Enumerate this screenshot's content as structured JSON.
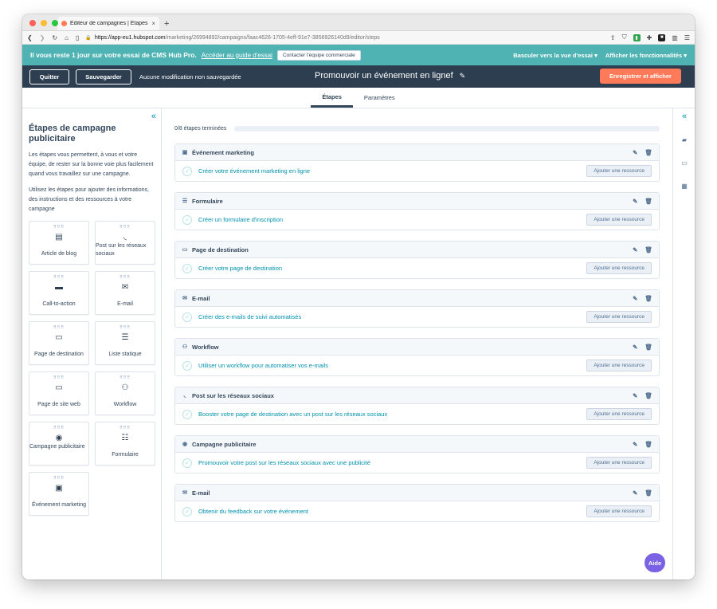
{
  "browser": {
    "tab_title": "Éditeur de campagnes | Étapes",
    "new_tab": "+",
    "url_host": "https://app-eu1.hubspot.com",
    "url_path": "/marketing/26994892/campaigns/faac4626-1705-4eff-91e7-3856926140d9/editor/steps"
  },
  "trial": {
    "message": "Il vous reste 1 jour sur votre essai de CMS Hub Pro.",
    "guide_link": "Accéder au guide d'essai",
    "contact_button": "Contacter l'équipe commerciale",
    "switch_view": "Basculer vers la vue d'essai ▾",
    "show_features": "Afficher les fonctionnalités ▾"
  },
  "editor": {
    "quit_label": "Quitter",
    "save_label": "Sauvegarder",
    "unsaved_status": "Aucune modification non sauvegardée",
    "campaign_title": "Promouvoir un événement en lignef",
    "publish_label": "Enregistrer et afficher"
  },
  "tabs": {
    "steps": "Étapes",
    "settings": "Paramètres"
  },
  "sidebar": {
    "title": "Étapes de campagne publicitaire",
    "para1": "Les étapes vous permettent, à vous et votre équipe, de rester sur la bonne voie plus facilement quand vous travaillez sur une campagne.",
    "para2": "Utilisez les étapes pour ajouter des informations, des instructions et des ressources à votre campagne",
    "tiles": [
      {
        "label": "Article de blog",
        "icon": "document-icon"
      },
      {
        "label": "Post sur les réseaux sociaux",
        "icon": "rss-icon"
      },
      {
        "label": "Call-to-action",
        "icon": "cta-icon"
      },
      {
        "label": "E-mail",
        "icon": "email-icon"
      },
      {
        "label": "Page de destination",
        "icon": "browser-icon"
      },
      {
        "label": "Liste statique",
        "icon": "list-icon"
      },
      {
        "label": "Page de site web",
        "icon": "browser-icon"
      },
      {
        "label": "Workflow",
        "icon": "workflow-icon"
      },
      {
        "label": "Campagne publicitaire",
        "icon": "ad-icon"
      },
      {
        "label": "Formulaire",
        "icon": "form-icon"
      },
      {
        "label": "Événement marketing",
        "icon": "event-icon"
      }
    ]
  },
  "progress": {
    "label": "0/8 étapes terminées",
    "fraction": 0
  },
  "steps": [
    {
      "type": "Événement marketing",
      "action": "Créer votre événement marketing en ligne",
      "button": "Ajouter une ressource"
    },
    {
      "type": "Formulaire",
      "action": "Créer un formulaire d'inscription",
      "button": "Ajouter une ressource"
    },
    {
      "type": "Page de destination",
      "action": "Créer votre page de destination",
      "button": "Ajouter une ressource"
    },
    {
      "type": "E-mail",
      "action": "Créer des e-mails de suivi automatisés",
      "button": "Ajouter une ressource"
    },
    {
      "type": "Workflow",
      "action": "Utiliser un workflow pour automatiser vos e-mails",
      "button": "Ajouter une ressource"
    },
    {
      "type": "Post sur les réseaux sociaux",
      "action": "Booster votre page de destination avec un post sur les réseaux sociaux",
      "button": "Ajouter une ressource"
    },
    {
      "type": "Campagne publicitaire",
      "action": "Promouvoir votre post sur les réseaux sociaux avec une publicité",
      "button": "Ajouter une ressource"
    },
    {
      "type": "E-mail",
      "action": "Obtenir du feedback sur votre événement",
      "button": "Ajouter une ressource"
    }
  ],
  "help_label": "Aide",
  "colors": {
    "accent": "#ff7a59",
    "header": "#2d3e50",
    "trial": "#4fb3b3",
    "link": "#0091ae",
    "help": "#7b62e4"
  }
}
